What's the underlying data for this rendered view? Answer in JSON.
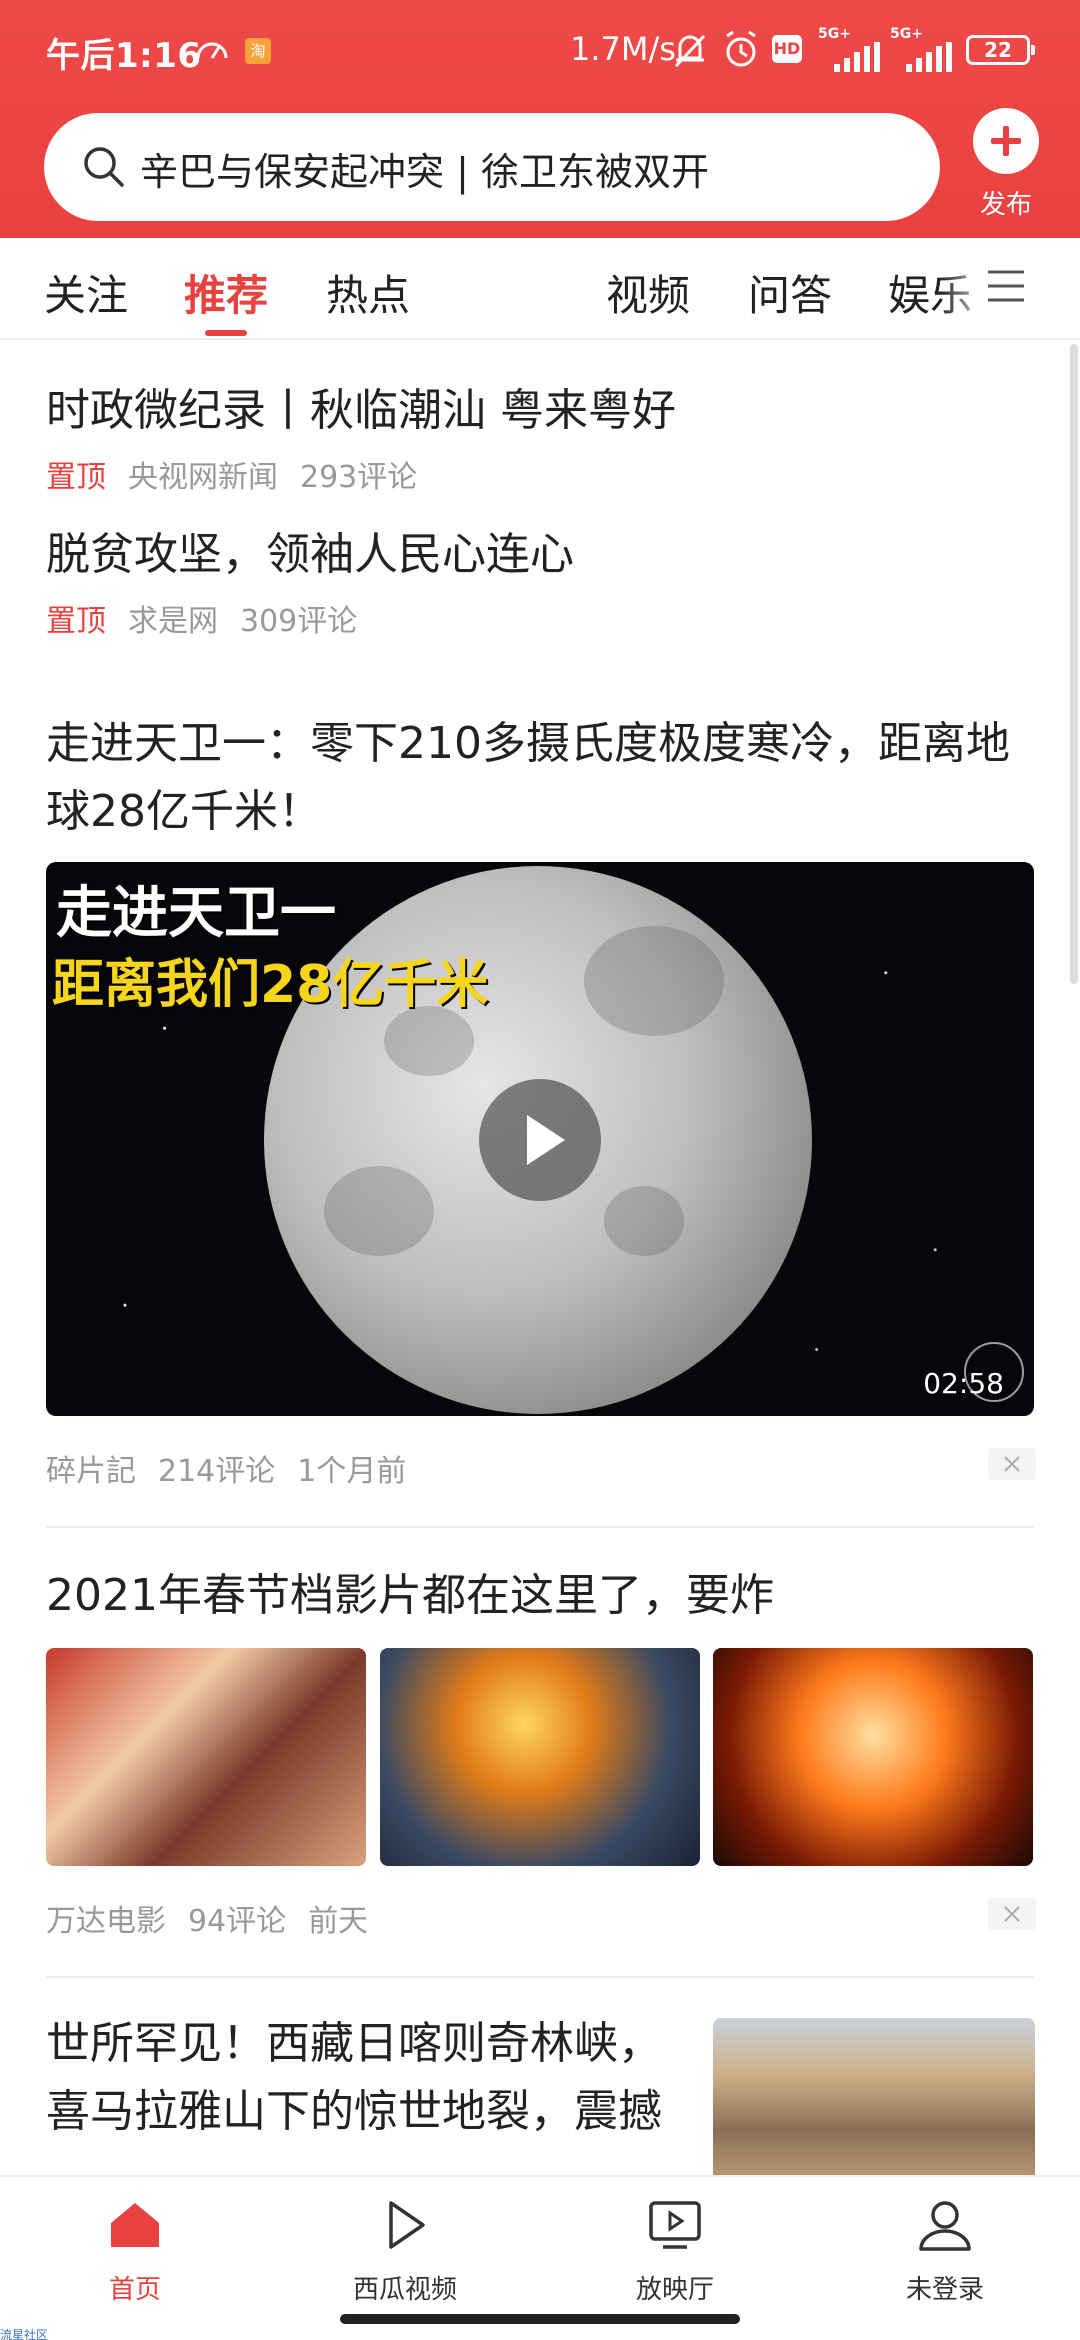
{
  "status_bar": {
    "time": "午后1:16",
    "app_badge": "淘",
    "net_speed": "1.7M/s",
    "hd_badge": "HD",
    "signal_1_tag": "5G+",
    "signal_2_tag": "5G+",
    "battery": "22"
  },
  "search": {
    "text": "辛巴与保安起冲突 | 徐卫东被双开"
  },
  "publish": {
    "label": "发布"
  },
  "tabs": [
    {
      "label": "关注",
      "active": false
    },
    {
      "label": "推荐",
      "active": true
    },
    {
      "label": "热点",
      "active": false
    },
    {
      "label": "视频",
      "active": false
    },
    {
      "label": "问答",
      "active": false
    },
    {
      "label": "娱乐",
      "active": false
    }
  ],
  "feed": {
    "pinned": [
      {
        "title": "时政微纪录丨秋临潮汕 粤来粤好",
        "tag": "置顶",
        "source": "央视网新闻",
        "comments": "293评论"
      },
      {
        "title": "脱贫攻坚，领袖人民心连心",
        "tag": "置顶",
        "source": "求是网",
        "comments": "309评论"
      }
    ],
    "video_article": {
      "title": "走进天卫一：零下210多摄氏度极度寒冷，距离地球28亿千米！",
      "overlay_line1": "走进天卫一",
      "overlay_line2": "距离我们28亿千米",
      "duration": "02:58",
      "source": "碎片記",
      "comments": "214评论",
      "time": "1个月前"
    },
    "gallery_article": {
      "title": "2021年春节档影片都在这里了，要炸",
      "source": "万达电影",
      "comments": "94评论",
      "time": "前天"
    },
    "last_article": {
      "title": "世所罕见！西藏日喀则奇林峡，喜马拉雅山下的惊世地裂，震撼"
    }
  },
  "bottom_nav": [
    {
      "label": "首页",
      "active": true
    },
    {
      "label": "西瓜视频",
      "active": false
    },
    {
      "label": "放映厅",
      "active": false
    },
    {
      "label": "未登录",
      "active": false
    }
  ],
  "corner_tag": "流星社区",
  "colors": {
    "brand_red": "#e9413f",
    "meta_gray": "#999999"
  }
}
